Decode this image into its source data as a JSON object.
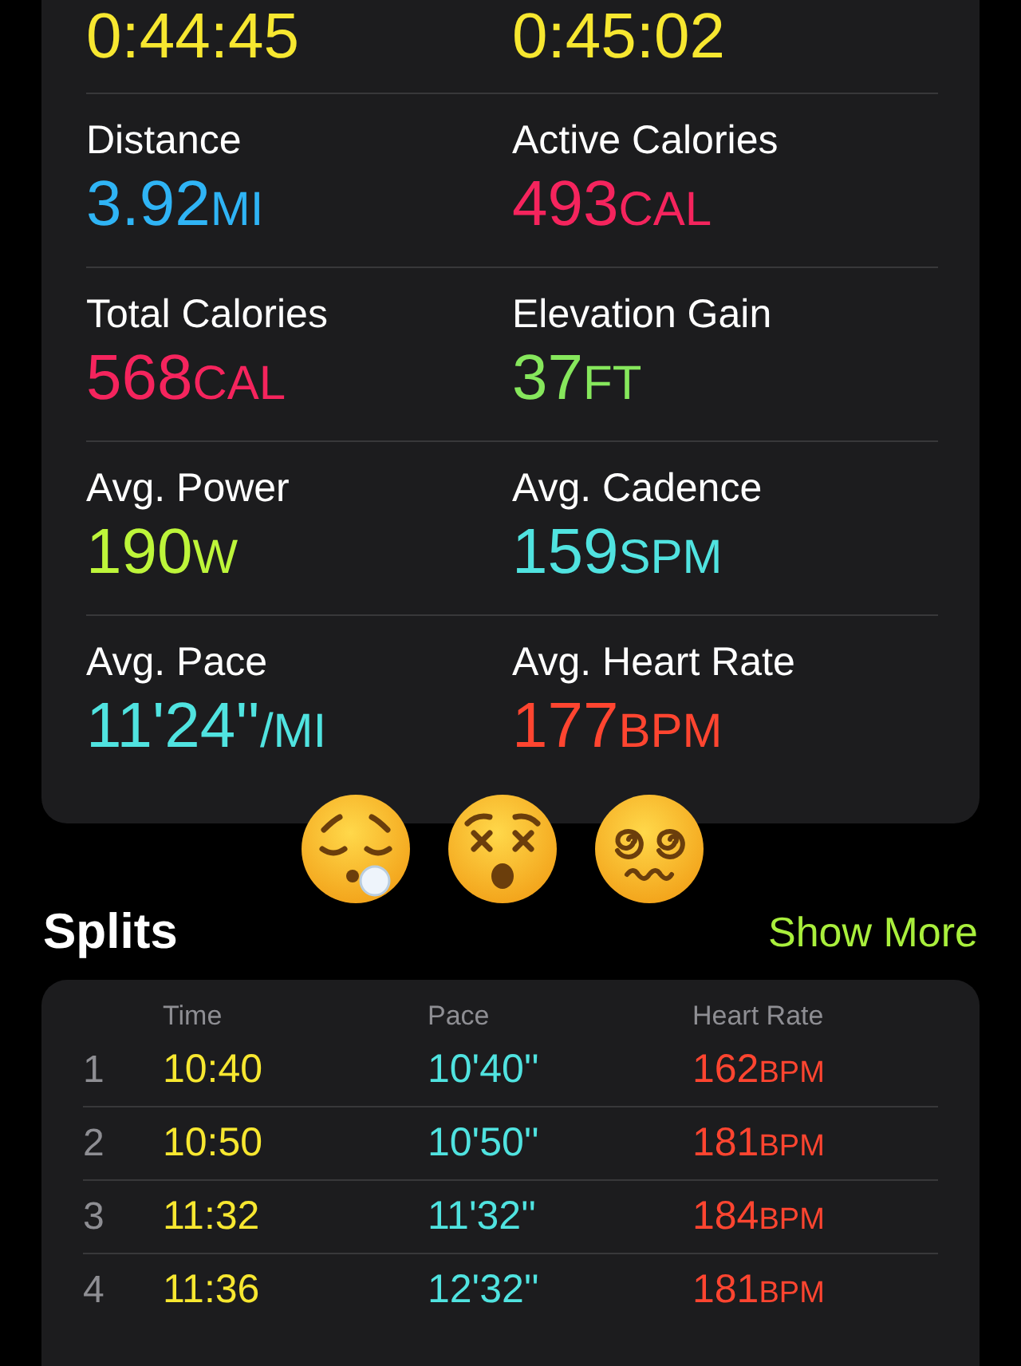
{
  "summary": {
    "metrics": [
      {
        "value": "0:44:45",
        "color": "#f7e730"
      },
      {
        "value": "0:45:02",
        "color": "#f7e730"
      },
      {
        "label": "Distance",
        "value": "3.92",
        "unit": "MI",
        "color": "#2fb4f5"
      },
      {
        "label": "Active Calories",
        "value": "493",
        "unit": "CAL",
        "color": "#f5245d"
      },
      {
        "label": "Total Calories",
        "value": "568",
        "unit": "CAL",
        "color": "#f5245d"
      },
      {
        "label": "Elevation Gain",
        "value": "37",
        "unit": "FT",
        "color": "#86e75c"
      },
      {
        "label": "Avg. Power",
        "value": "190",
        "unit": "W",
        "color": "#bdf53a"
      },
      {
        "label": "Avg. Cadence",
        "value": "159",
        "unit": "SPM",
        "color": "#50e3e0"
      },
      {
        "label": "Avg. Pace",
        "value": "11'24''",
        "unit": "/MI",
        "color": "#50e3e0"
      },
      {
        "label": "Avg. Heart Rate",
        "value": "177",
        "unit": "BPM",
        "color": "#ff4530"
      }
    ]
  },
  "reactions": [
    {
      "kind": "exhale"
    },
    {
      "kind": "dizzy"
    },
    {
      "kind": "spiral"
    }
  ],
  "splits": {
    "title": "Splits",
    "action": "Show More",
    "columns": [
      "Time",
      "Pace",
      "Heart Rate"
    ],
    "rows": [
      {
        "index": "1",
        "time": "10:40",
        "pace": "10'40''",
        "heart_rate": "162",
        "unit": "BPM"
      },
      {
        "index": "2",
        "time": "10:50",
        "pace": "10'50''",
        "heart_rate": "181",
        "unit": "BPM"
      },
      {
        "index": "3",
        "time": "11:32",
        "pace": "11'32''",
        "heart_rate": "184",
        "unit": "BPM"
      },
      {
        "index": "4",
        "time": "11:36",
        "pace": "12'32''",
        "heart_rate": "181",
        "unit": "BPM"
      }
    ]
  }
}
